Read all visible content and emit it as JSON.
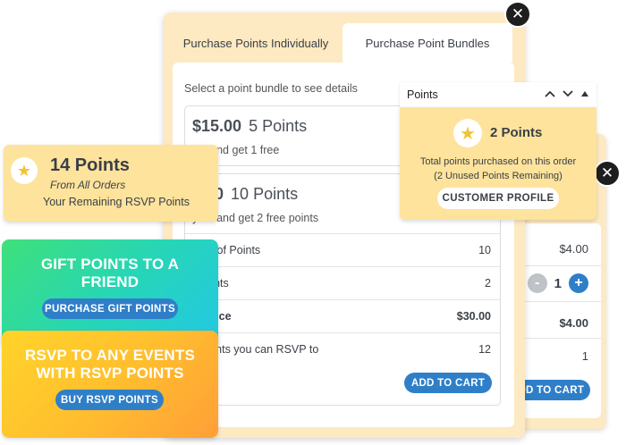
{
  "colors": {
    "accent_blue": "#2f7fc8",
    "card_cream": "#fde9c2",
    "card_yellow": "#fde39c",
    "gift_gradient_start": "#3fe07a",
    "gift_gradient_end": "#22c8e6",
    "rsvp_gradient_start": "#ffd42a",
    "rsvp_gradient_end": "#ff9f37",
    "close_black": "#1e1e1e"
  },
  "tabs": [
    {
      "label": "Purchase Points Individually",
      "active": false
    },
    {
      "label": "Purchase Point Bundles",
      "active": true
    }
  ],
  "bundles": {
    "hint": "Select a point bundle to see details",
    "items": [
      {
        "price": "$15.00",
        "points": "5 Points",
        "subtitle": "y 5 and get 1 free"
      },
      {
        "price": "0.00",
        "points": "10 Points",
        "subtitle": "y 10 and get 2 free points"
      }
    ],
    "details": [
      {
        "label": "ber of Points",
        "value": "10",
        "bold": false
      },
      {
        "label": "Points",
        "value": "2",
        "bold": false
      },
      {
        "label": "l Price",
        "value": "$30.00",
        "bold": true
      },
      {
        "label": "events you can RSVP to",
        "value": "12",
        "bold": false
      }
    ],
    "add_to_cart": "ADD TO CART"
  },
  "cart_back": {
    "price": "$4.00",
    "quantity": "1",
    "minus": "-",
    "plus": "+",
    "subtotal": "$4.00",
    "count": "1",
    "add_to_cart": "ADD TO CART"
  },
  "points_panel": {
    "header": "Points",
    "up_icon": "chevron-up-icon",
    "down_icon": "chevron-down-icon",
    "collapse_icon": "triangle-up-icon",
    "count": "2 Points",
    "description_line1": "Total points purchased on this order",
    "description_line2": "(2 Unused Points Remaining)",
    "profile_button": "CUSTOMER PROFILE"
  },
  "remaining": {
    "title": "14 Points",
    "from": "From All Orders",
    "subtitle": "Your Remaining RSVP Points"
  },
  "gift": {
    "title_line1": "GIFT POINTS TO A",
    "title_line2": "FRIEND",
    "button": "PURCHASE GIFT POINTS"
  },
  "rsvp": {
    "title_line1": "RSVP TO ANY EVENTS",
    "title_line2": "WITH RSVP POINTS",
    "button": "BUY RSVP POINTS"
  },
  "close_glyph": "✕",
  "star_glyph": "★"
}
